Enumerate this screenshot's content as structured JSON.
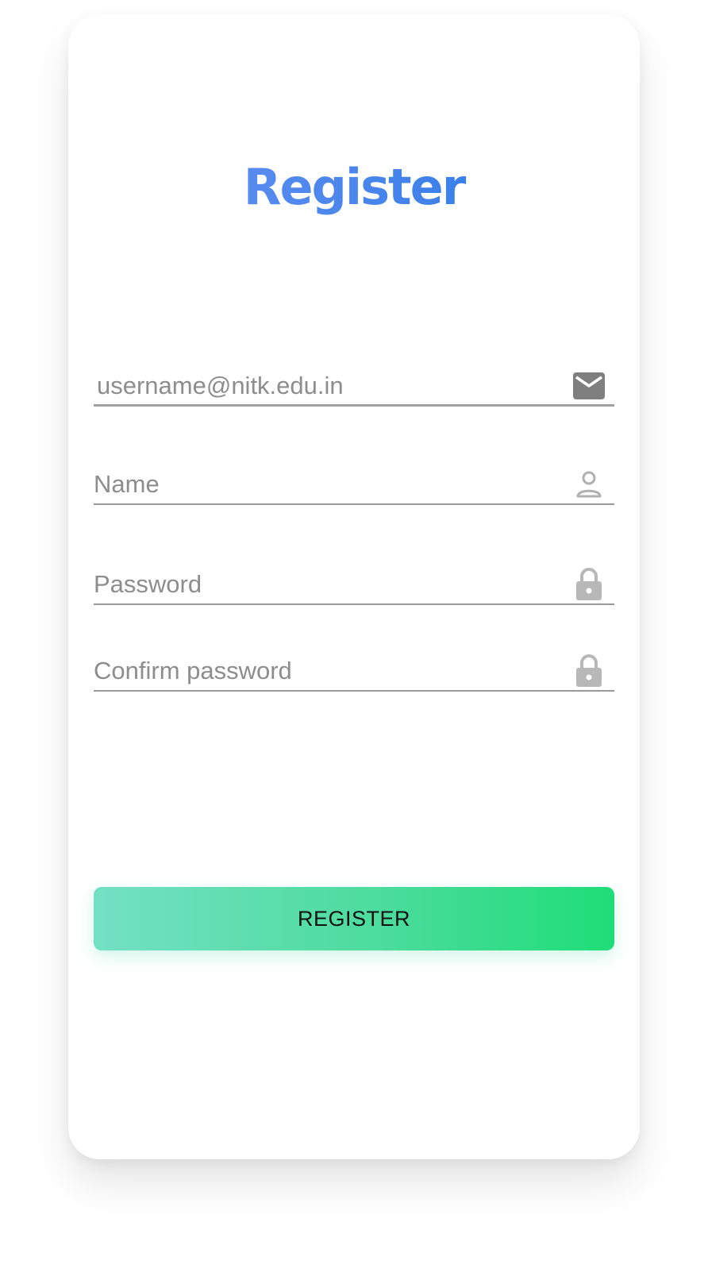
{
  "header": {
    "title": "Register"
  },
  "form": {
    "email": {
      "placeholder": "username@nitk.edu.in",
      "icon": "mail-icon"
    },
    "name": {
      "placeholder": "Name",
      "icon": "person-icon"
    },
    "password": {
      "placeholder": "Password",
      "icon": "lock-icon"
    },
    "confirm_password": {
      "placeholder": "Confirm password",
      "icon": "lock-icon"
    },
    "submit_label": "REGISTER"
  },
  "colors": {
    "title_gradient_start": "#6e93f2",
    "title_gradient_end": "#2374e6",
    "button_gradient_start": "#73e0c4",
    "button_gradient_end": "#1edd77",
    "icon_gray": "#9a9a9a"
  }
}
